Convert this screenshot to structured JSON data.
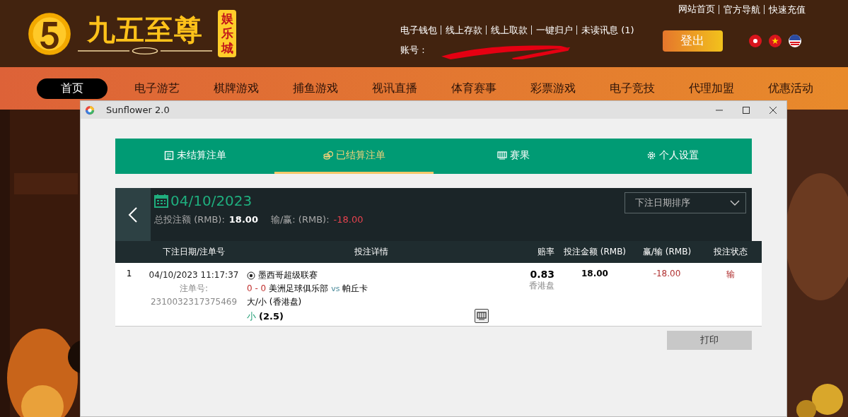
{
  "site": {
    "logo_title": "九五至尊",
    "logo_badge": "娱乐城",
    "top_links": [
      "网站首页",
      "官方导航",
      "快速充值"
    ],
    "account_links": [
      "电子钱包",
      "线上存款",
      "线上取款",
      "一键归户",
      "未读讯息 (1)"
    ],
    "account_label": "账号 :",
    "logout": "登出",
    "nav": [
      {
        "label": "首页",
        "selected": true
      },
      {
        "label": "电子游艺",
        "selected": false
      },
      {
        "label": "棋牌游戏",
        "selected": false
      },
      {
        "label": "捕鱼游戏",
        "selected": false
      },
      {
        "label": "视讯直播",
        "selected": false
      },
      {
        "label": "体育赛事",
        "selected": false
      },
      {
        "label": "彩票游戏",
        "selected": false
      },
      {
        "label": "电子竞技",
        "selected": false
      },
      {
        "label": "代理加盟",
        "selected": false
      },
      {
        "label": "优惠活动",
        "selected": false
      }
    ]
  },
  "window": {
    "title": "Sunflower 2.0",
    "tabs": [
      {
        "label": "未结算注单",
        "kind": "unsettled",
        "selected": false
      },
      {
        "label": "已结算注单",
        "kind": "settled",
        "selected": true
      },
      {
        "label": "赛果",
        "kind": "results",
        "selected": false
      },
      {
        "label": "个人设置",
        "kind": "settings",
        "selected": false
      }
    ],
    "summary": {
      "date": "04/10/2023",
      "total_label": "总投注额 (RMB):",
      "total": "18.00",
      "winloss_label": "输/赢: (RMB):",
      "winloss": "-18.00",
      "sort_select": "下注日期排序"
    },
    "table": {
      "columns": [
        "下注日期/注单号",
        "投注详情",
        "赔率",
        "投注金额 (RMB)",
        "赢/输 (RMB)",
        "投注状态"
      ],
      "rows": [
        {
          "index": "1",
          "datetime": "04/10/2023 11:17:37",
          "ticket_label": "注单号:",
          "ticket": "2310032317375469",
          "league": "墨西哥超级联赛",
          "score": "0 - 0",
          "home": "美洲足球俱乐部",
          "vs": "vs",
          "away": "帕丘卡",
          "market": "大/小 (香港盘)",
          "pick": "小",
          "line": "(2.5)",
          "odds": "0.83",
          "odds_type": "香港盘",
          "stake": "18.00",
          "winloss": "-18.00",
          "status": "输"
        }
      ]
    },
    "print_button": "打印"
  }
}
